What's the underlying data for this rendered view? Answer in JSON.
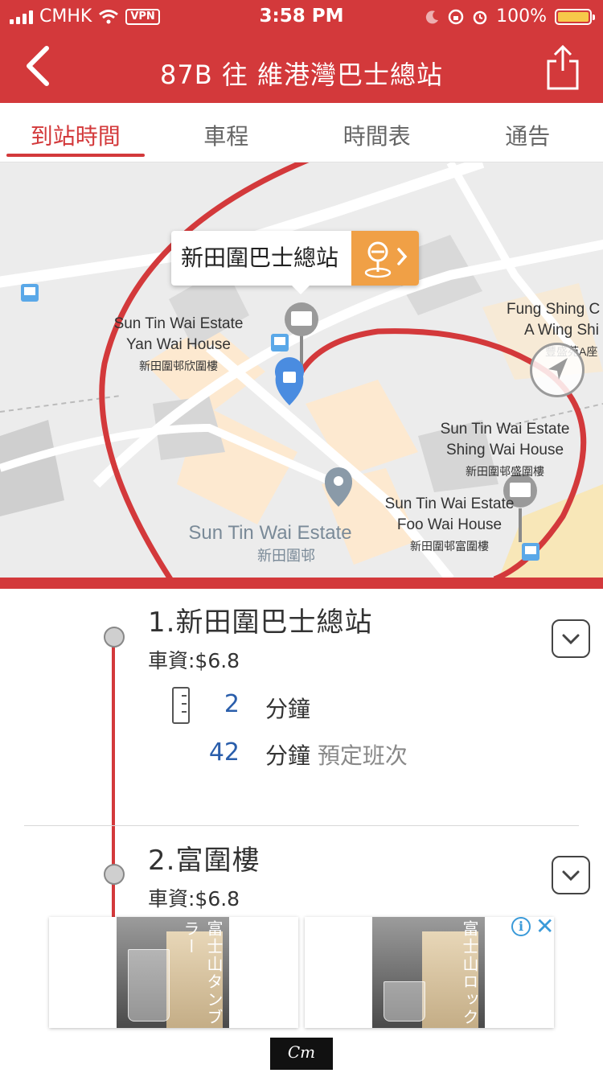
{
  "status_bar": {
    "carrier": "CMHK",
    "vpn": "VPN",
    "time": "3:58 PM",
    "battery": "100%"
  },
  "header": {
    "title": "87B 往 維港灣巴士總站",
    "back_icon": "chevron-left-icon",
    "share_icon": "share-icon"
  },
  "tabs": [
    {
      "label": "到站時間",
      "active": true
    },
    {
      "label": "車程",
      "active": false
    },
    {
      "label": "時間表",
      "active": false
    },
    {
      "label": "通告",
      "active": false
    }
  ],
  "map": {
    "callout": "新田圍巴士總站",
    "labels": {
      "fung_shing_en1": "Fung Shing C",
      "fung_shing_en2": "A Wing Shi",
      "fung_shing_zh": "豐盛苑A座",
      "yan_wai_en1": "Sun Tin Wai Estate",
      "yan_wai_en2": "Yan Wai House",
      "yan_wai_zh": "新田圍邨欣圍樓",
      "shing_wai_en1": "Sun Tin Wai Estate",
      "shing_wai_en2": "Shing Wai House",
      "shing_wai_zh": "新田圍邨盛圍樓",
      "foo_wai_en1": "Sun Tin Wai Estate",
      "foo_wai_en2": "Foo Wai House",
      "foo_wai_zh": "新田圍邨富圍樓",
      "estate_en": "Sun Tin Wai Estate",
      "estate_zh": "新田圍邨"
    },
    "route_color": "#d3393b"
  },
  "stops": [
    {
      "name": "1.新田圍巴士總站",
      "fare": "車資:$6.8",
      "etas": [
        {
          "minutes": "2",
          "unit": "分鐘",
          "note": ""
        },
        {
          "minutes": "42",
          "unit": "分鐘",
          "note": "預定班次"
        }
      ]
    },
    {
      "name": "2.富圍樓",
      "fare": "車資:$6.8"
    }
  ],
  "ad": {
    "left_text": "富士山タンブラー",
    "right_text": "富士山ロック",
    "info": "i",
    "close": "✕",
    "logo": "Cm"
  },
  "colors": {
    "brand_red": "#d3393b",
    "eta_blue": "#2a5eab",
    "callout_orange": "#f0a046"
  }
}
